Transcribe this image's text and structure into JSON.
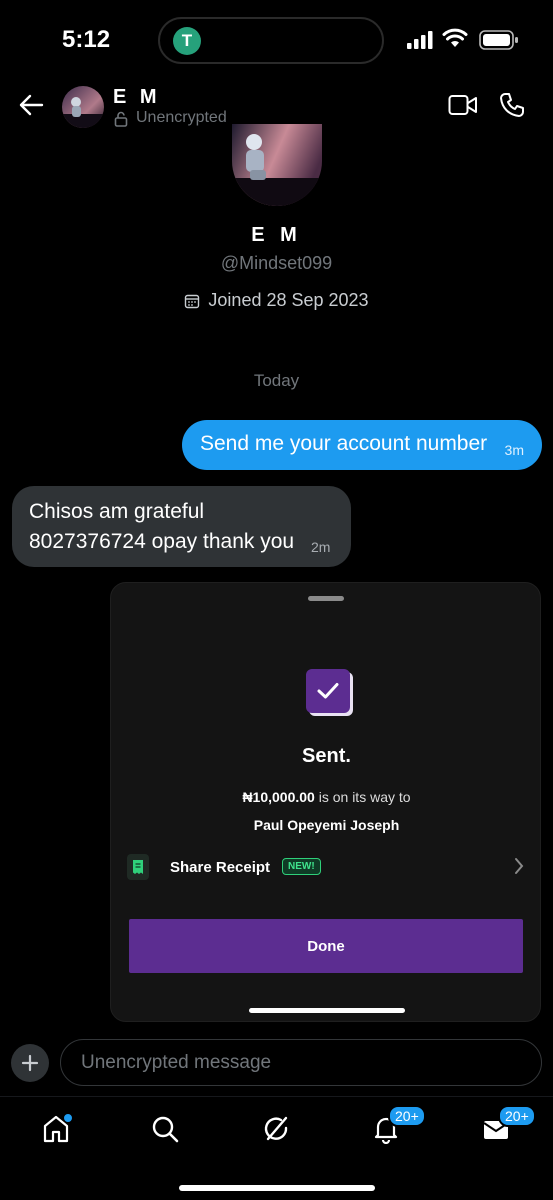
{
  "status_bar": {
    "time": "5:12",
    "app_indicator": "T"
  },
  "header": {
    "name": "E M",
    "subtitle": "Unencrypted"
  },
  "profile": {
    "name": "E M",
    "handle": "@Mindset099",
    "joined": "Joined 28 Sep 2023"
  },
  "conversation": {
    "date_divider": "Today",
    "messages": [
      {
        "direction": "outgoing",
        "text": "Send me your account number",
        "time": "3m"
      },
      {
        "direction": "incoming",
        "lines": [
          "Chisos am grateful",
          "8027376724 opay thank you"
        ],
        "time": "2m"
      }
    ]
  },
  "receipt_image": {
    "title": "Sent.",
    "amount": "₦10,000.00",
    "amount_suffix": " is on its way to",
    "recipient": "Paul Opeyemi Joseph",
    "share_label": "Share Receipt",
    "new_badge": "NEW!",
    "done_label": "Done"
  },
  "composer": {
    "placeholder": "Unencrypted message"
  },
  "tabbar": {
    "items": [
      {
        "name": "home",
        "badge": ""
      },
      {
        "name": "search",
        "badge": ""
      },
      {
        "name": "grok",
        "badge": ""
      },
      {
        "name": "notifications",
        "badge": "20+"
      },
      {
        "name": "messages",
        "badge": "20+"
      }
    ]
  },
  "colors": {
    "accent": "#1d9bf0",
    "receipt_purple": "#5c2d91",
    "incoming_bubble": "#2f3336"
  }
}
